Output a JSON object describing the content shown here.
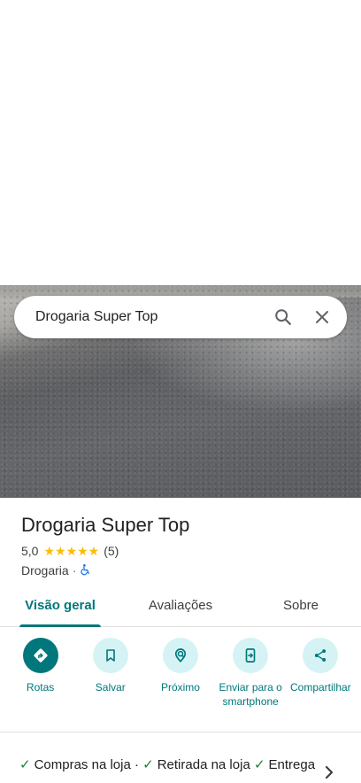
{
  "search": {
    "query": "Drogaria Super Top"
  },
  "place": {
    "name": "Drogaria Super Top",
    "rating": "5,0",
    "stars": "★★★★★",
    "review_count": "(5)",
    "category": "Drogaria",
    "separator": "·"
  },
  "tabs": [
    {
      "label": "Visão geral",
      "active": true
    },
    {
      "label": "Avaliações",
      "active": false
    },
    {
      "label": "Sobre",
      "active": false
    }
  ],
  "actions": [
    {
      "label": "Rotas",
      "icon": "directions-icon"
    },
    {
      "label": "Salvar",
      "icon": "bookmark-icon"
    },
    {
      "label": "Próximo",
      "icon": "nearby-icon"
    },
    {
      "label": "Enviar para o smartphone",
      "icon": "send-to-phone-icon"
    },
    {
      "label": "Compartilhar",
      "icon": "share-icon"
    }
  ],
  "services": [
    {
      "label": "Compras na loja",
      "separator": "·"
    },
    {
      "label": "Retirada na loja",
      "separator": "·"
    },
    {
      "label": "Entrega",
      "separator": ""
    }
  ],
  "colors": {
    "accent": "#00777b",
    "action_bg": "#d5f3f4",
    "star": "#fbbc04",
    "check": "#188038"
  }
}
